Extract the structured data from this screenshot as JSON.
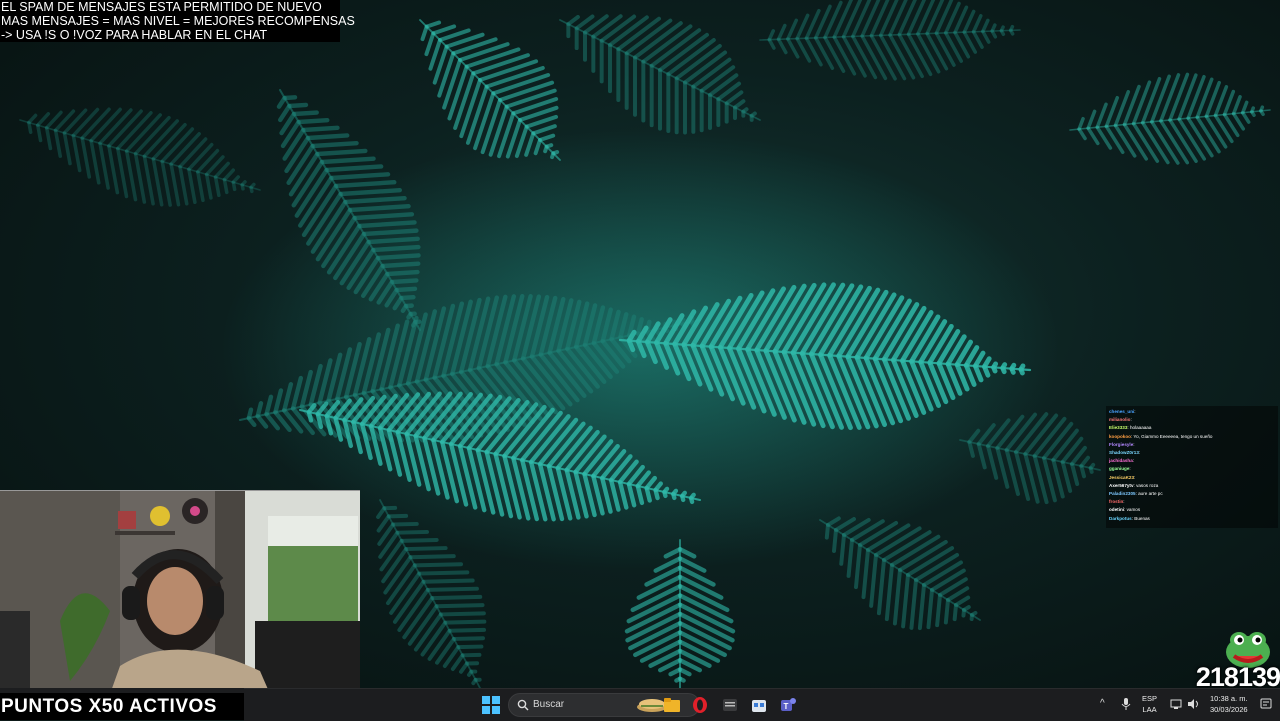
{
  "overlay": {
    "lines": [
      "EL SPAM DE MENSAJES ESTA PERMITIDO DE NUEVO",
      "MAS MENSAJES = MAS NIVEL = MEJORES RECOMPENSAS",
      "-> USA !S  O !VOZ PARA HABLAR EN EL CHAT"
    ]
  },
  "chat": {
    "messages": [
      {
        "user": "chenes_uni",
        "text": ": ",
        "color": "#4aa3ff"
      },
      {
        "user": "milianolio",
        "text": ": ",
        "color": "#ff7a7a"
      },
      {
        "user": "Elie3333",
        "text": ": holaaaaaa",
        "color": "#c9ff6b"
      },
      {
        "user": "koopokoo",
        "text": ": Yo, Giammo Eeeeeea, tengo un sueño",
        "color": "#ff9f43"
      },
      {
        "user": "Florgiesyle",
        "text": ": ",
        "color": "#b388ff"
      },
      {
        "user": "ShadowZ0r13",
        "text": ": ",
        "color": "#7ad7ff"
      },
      {
        "user": "jachidasha",
        "text": ": ",
        "color": "#ff6fd8"
      },
      {
        "user": "gganiuge",
        "text": ": ",
        "color": "#9aff9a"
      },
      {
        "user": "JessicaK23",
        "text": ": ",
        "color": "#ffd166"
      },
      {
        "user": "Axer567ytv",
        "text": ": vasos roza",
        "color": "#ffffff"
      },
      {
        "user": "Paladin2305",
        "text": ": aure arte pc",
        "color": "#7ec8ff"
      },
      {
        "user": "frostin",
        "text": ": ",
        "color": "#ff6b6b"
      },
      {
        "user": "odetini",
        "text": ": vamos",
        "color": "#ffffff"
      },
      {
        "user": "Darkpotus",
        "text": ": Buenas",
        "color": "#6bd5ff"
      }
    ]
  },
  "points_banner": "PUNTOS X50 ACTIVOS",
  "counter": "218139",
  "taskbar": {
    "search_placeholder": "Buscar",
    "lang_line1": "ESP",
    "lang_line2": "LAA",
    "time": "10:38 a. m.",
    "date": "30/03/2026",
    "icons": [
      "windows-start-icon",
      "search-icon",
      "file-explorer-icon",
      "opera-icon",
      "app-icon",
      "store-icon",
      "teams-icon"
    ]
  },
  "colors": {
    "fern": "#2fb8a8",
    "fern_dark": "#1d7f74",
    "taskbar": "#1c1d1f"
  }
}
